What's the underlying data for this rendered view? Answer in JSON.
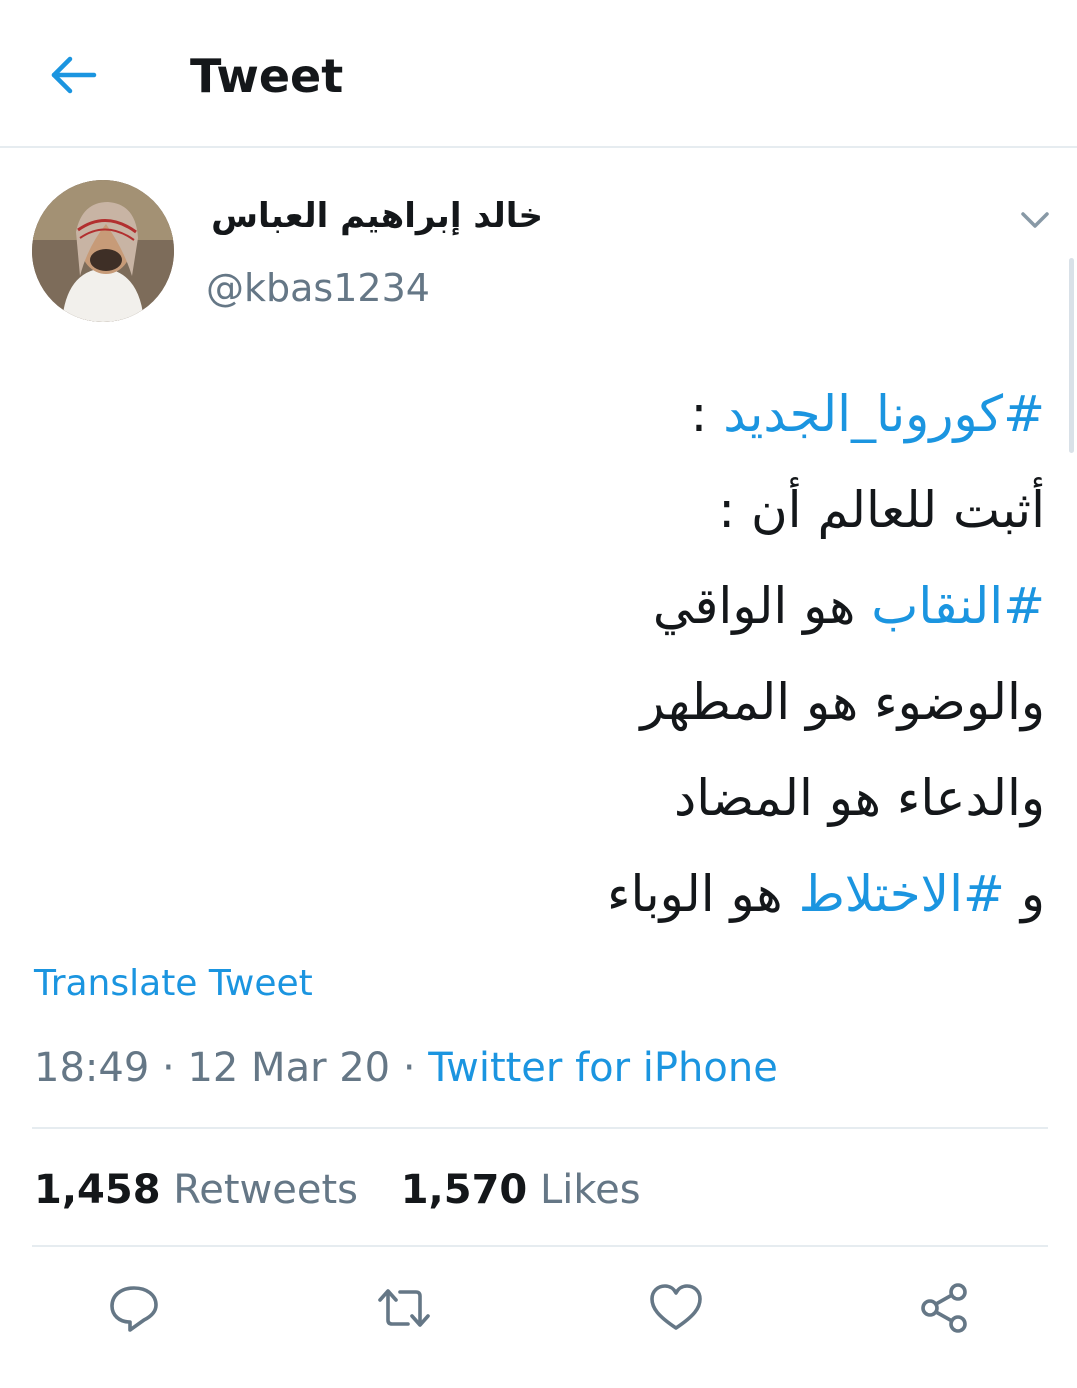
{
  "header": {
    "title": "Tweet",
    "back_icon": "arrow-left-icon"
  },
  "colors": {
    "accent": "#1b95e0",
    "text_primary": "#14171a",
    "text_secondary": "#657786",
    "divider": "#e6ecf0"
  },
  "author": {
    "display_name": "خالد إبراهيم العباس",
    "handle": "@kbas1234",
    "avatar_icon": "avatar-photo",
    "menu_icon": "chevron-down-icon"
  },
  "tweet": {
    "lines": [
      [
        {
          "text": "#كورونا_الجديد",
          "hashtag": true
        },
        {
          "text": " :",
          "hashtag": false
        }
      ],
      [
        {
          "text": "أثبت للعالم أن :",
          "hashtag": false
        }
      ],
      [
        {
          "text": "#النقاب",
          "hashtag": true
        },
        {
          "text": " هو الواقي",
          "hashtag": false
        }
      ],
      [
        {
          "text": "والوضوء هو المطهر",
          "hashtag": false
        }
      ],
      [
        {
          "text": "والدعاء هو المضاد",
          "hashtag": false
        }
      ],
      [
        {
          "text": "و ",
          "hashtag": false
        },
        {
          "text": "#الاختلاط",
          "hashtag": true
        },
        {
          "text": " هو الوباء",
          "hashtag": false
        }
      ]
    ],
    "translate_label": "Translate Tweet",
    "time": "18:49",
    "separator": "·",
    "date": "12 Mar 20",
    "source": "Twitter for iPhone"
  },
  "stats": {
    "retweets_count": "1,458",
    "retweets_label": "Retweets",
    "likes_count": "1,570",
    "likes_label": "Likes"
  },
  "actions": [
    "reply-icon",
    "retweet-icon",
    "like-icon",
    "share-icon"
  ]
}
